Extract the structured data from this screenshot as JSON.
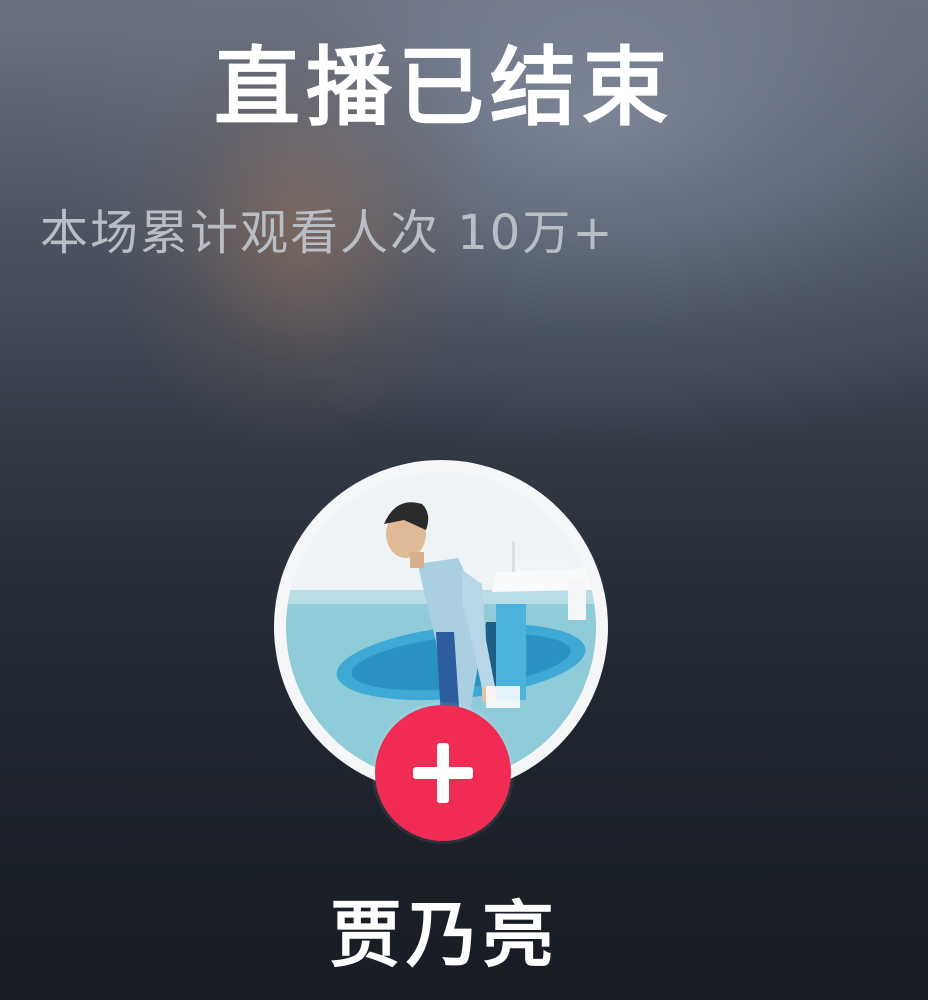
{
  "live_end": {
    "title": "直播已结束",
    "viewer_summary": "本场累计观看人次 10万+"
  },
  "host": {
    "name": "贾乃亮",
    "avatar_description_icon": "profile-photo",
    "follow_icon": "plus-icon"
  },
  "colors": {
    "follow_button": "#f02c55",
    "title_text": "#ffffff",
    "subtitle_text": "#b9bdc4"
  }
}
